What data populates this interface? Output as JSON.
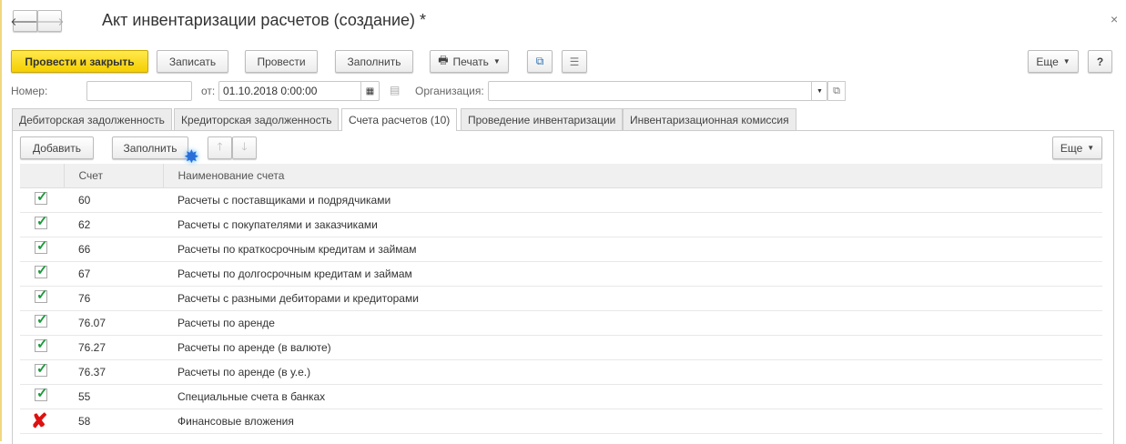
{
  "title": "Акт инвентаризации расчетов (создание) *",
  "toolbar": {
    "post_close": "Провести и закрыть",
    "save": "Записать",
    "post": "Провести",
    "fill": "Заполнить",
    "print": "Печать",
    "more": "Еще",
    "help": "?"
  },
  "fields": {
    "number_label": "Номер:",
    "number_value": "",
    "date_label": "от:",
    "date_value": "01.10.2018  0:00:00",
    "org_label": "Организация:",
    "org_value": ""
  },
  "tabs": [
    "Дебиторская задолженность",
    "Кредиторская задолженность",
    "Счета расчетов (10)",
    "Проведение инвентаризации",
    "Инвентаризационная комиссия"
  ],
  "table_toolbar": {
    "add": "Добавить",
    "fill": "Заполнить",
    "more": "Еще"
  },
  "columns": [
    "Счет",
    "Наименование счета"
  ],
  "rows": [
    {
      "checked": true,
      "account": "60",
      "name": "Расчеты с поставщиками и подрядчиками"
    },
    {
      "checked": true,
      "account": "62",
      "name": "Расчеты с покупателями и заказчиками"
    },
    {
      "checked": true,
      "account": "66",
      "name": "Расчеты по краткосрочным кредитам и займам"
    },
    {
      "checked": true,
      "account": "67",
      "name": "Расчеты по долгосрочным кредитам и займам"
    },
    {
      "checked": true,
      "account": "76",
      "name": "Расчеты с разными дебиторами и кредиторами"
    },
    {
      "checked": true,
      "account": "76.07",
      "name": "Расчеты по аренде"
    },
    {
      "checked": true,
      "account": "76.27",
      "name": "Расчеты по аренде (в валюте)"
    },
    {
      "checked": true,
      "account": "76.37",
      "name": "Расчеты по аренде (в у.е.)"
    },
    {
      "checked": true,
      "account": "55",
      "name": "Специальные счета в банках"
    },
    {
      "checked": false,
      "account": "58",
      "name": "Финансовые вложения"
    }
  ]
}
